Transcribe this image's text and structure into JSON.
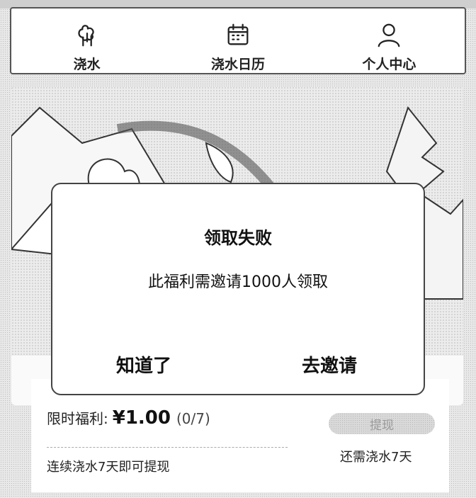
{
  "nav": {
    "items": [
      {
        "label": "浇水",
        "icon": "tree-icon"
      },
      {
        "label": "浇水日历",
        "icon": "calendar-icon"
      },
      {
        "label": "个人中心",
        "icon": "user-icon"
      }
    ]
  },
  "card": {
    "benefit_label": "限时福利:",
    "benefit_amount": "¥1.00",
    "benefit_count": "(0/7)",
    "withdraw_label": "提现",
    "hint": "连续浇水7天即可提现",
    "remaining": "还需浇水7天"
  },
  "dialog": {
    "title": "领取失败",
    "message": "此福利需邀请1000人领取",
    "ok_label": "知道了",
    "invite_label": "去邀请"
  },
  "colors": {
    "background": "#e8e8e8",
    "dialog_border": "#444444",
    "disabled_button": "#d9d9d9"
  }
}
